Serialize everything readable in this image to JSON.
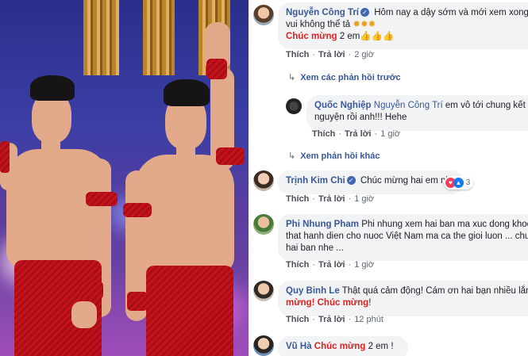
{
  "comments": [
    {
      "name": "Nguyễn Công Trí",
      "text": "Hôm nay a dậy sớm và mới xem xong, một",
      "line2_pre": "vui không thể tả",
      "emojis1": "✹✹✹",
      "line3_red": "Chúc mừng",
      "line3_post": "2 em",
      "emojis2": "👍👍👍",
      "time": "2 giờ"
    },
    {
      "name": "Quốc Nghiệp",
      "mention": "Nguyễn Công Trí",
      "text": "em vô tới chung kết là mã",
      "line2": "nguyện rồi anh!!! Hehe",
      "time": "1 giờ"
    },
    {
      "name": "Trịnh Kim Chi",
      "text": "Chúc mừng hai em nhé.",
      "reaction_count": "3",
      "time": "1 giờ"
    },
    {
      "name": "Phi Nhung Pham",
      "text": "Phi nhung xem hai ban ma xuc dong khoc luon",
      "line2": "that hanh dien cho nuoc Việt Nam ma ca the gioi luon ... chuc m",
      "line3": "hai ban nhe ...",
      "time": "1 giờ"
    },
    {
      "name": "Quy Binh Le",
      "text": "Thật quá cảm động! Cám ơn hai bạn nhiều lắm!",
      "text_red_tail": "C",
      "line2_red": "mừng! Chúc mừng",
      "line2_post": "!",
      "time": "12 phút"
    },
    {
      "name": "Vũ Hà",
      "text_red": "Chúc mừng",
      "text_post": "2 em !"
    }
  ],
  "ui": {
    "like": "Thích",
    "reply": "Trả lời",
    "dot": "·",
    "view_previous": "Xem các phản hồi trước",
    "view_more": "Xem phản hồi khác",
    "verified": "✓",
    "arrow": "↳"
  }
}
